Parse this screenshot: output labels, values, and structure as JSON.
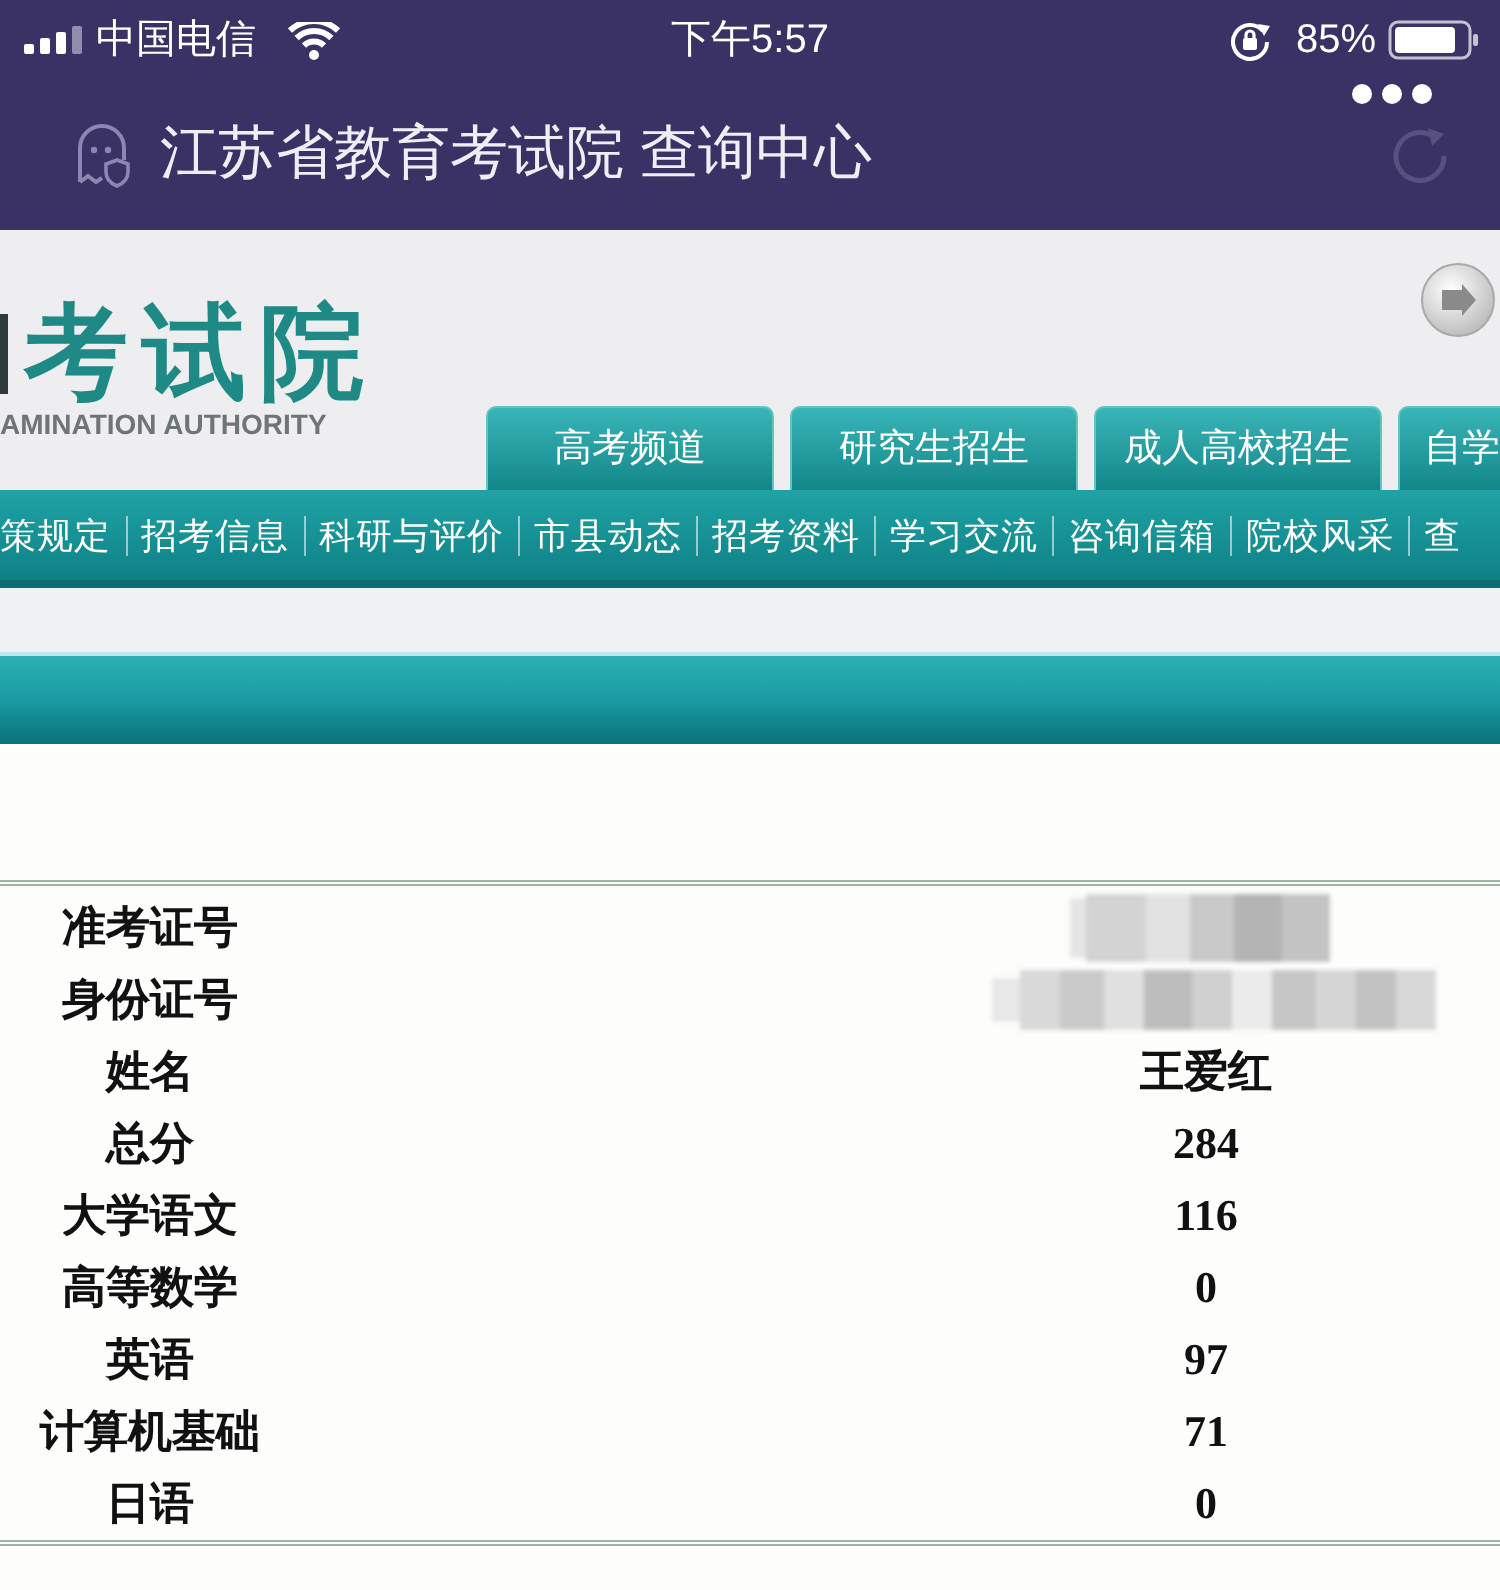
{
  "status_bar": {
    "carrier": "中国电信",
    "time": "下午5:57",
    "battery": "85%"
  },
  "nav_bar": {
    "title": "江苏省教育考试院 查询中心"
  },
  "site_header": {
    "logo_text": "考试院",
    "logo_subtitle": "AMINATION AUTHORITY"
  },
  "tabs": [
    {
      "label": "高考频道",
      "selected": false
    },
    {
      "label": "研究生招生",
      "selected": false
    },
    {
      "label": "成人高校招生",
      "selected": false
    },
    {
      "label": "自学",
      "selected": false
    }
  ],
  "menu": [
    "策规定",
    "招考信息",
    "科研与评价",
    "市县动态",
    "招考资料",
    "学习交流",
    "咨询信箱",
    "院校风采",
    "查"
  ],
  "results": [
    {
      "label": "准考证号",
      "kind": "redacted"
    },
    {
      "label": "身份证号",
      "kind": "redacted"
    },
    {
      "label": "姓名",
      "kind": "text",
      "value": "王爱红"
    },
    {
      "label": "总分",
      "kind": "number",
      "value": "284"
    },
    {
      "label": "大学语文",
      "kind": "number",
      "value": "116"
    },
    {
      "label": "高等数学",
      "kind": "number",
      "value": "0"
    },
    {
      "label": "英语",
      "kind": "number",
      "value": "97"
    },
    {
      "label": "计算机基础",
      "kind": "number",
      "value": "71"
    },
    {
      "label": "日语",
      "kind": "number",
      "value": "0"
    }
  ]
}
